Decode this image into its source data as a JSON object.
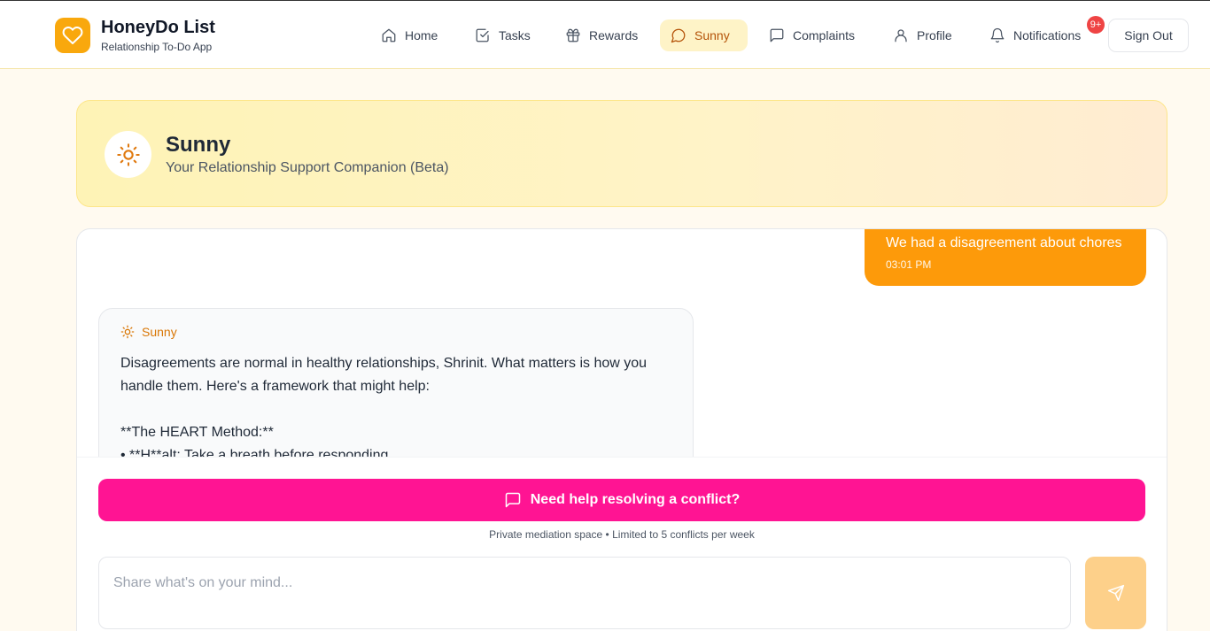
{
  "app": {
    "title": "HoneyDo List",
    "subtitle": "Relationship To-Do App",
    "icon": "heart-icon"
  },
  "nav": {
    "items": [
      {
        "label": "Home",
        "icon": "home-icon"
      },
      {
        "label": "Tasks",
        "icon": "checkbox-icon"
      },
      {
        "label": "Rewards",
        "icon": "gift-icon"
      },
      {
        "label": "Sunny",
        "icon": "chat-bubble-icon",
        "active": true
      },
      {
        "label": "Complaints",
        "icon": "message-square-icon"
      },
      {
        "label": "Profile",
        "icon": "user-icon"
      },
      {
        "label": "Notifications",
        "icon": "bell-icon"
      }
    ],
    "notification_badge": "9+",
    "sign_out": "Sign Out"
  },
  "hero": {
    "title": "Sunny",
    "subtitle": "Your Relationship Support Companion (Beta)",
    "icon": "sun-icon"
  },
  "chat": {
    "user_message": {
      "text": "We had a disagreement about chores",
      "time": "03:01 PM"
    },
    "bot_message": {
      "name": "Sunny",
      "text": "Disagreements are normal in healthy relationships, Shrinit. What matters is how you handle them. Here's a framework that might help:\n\n**The HEART Method:**\n• **H**alt: Take a breath before responding"
    }
  },
  "composer": {
    "conflict_button": "Need help resolving a conflict?",
    "note": "Private mediation space • Limited to 5 conflicts per week",
    "placeholder": "Share what's on your mind...",
    "send_icon": "send-icon"
  },
  "colors": {
    "accent": "#fd9a0a",
    "conflict": "#ff1493",
    "active_nav_bg": "#fef3c7",
    "badge": "#ef4444"
  }
}
